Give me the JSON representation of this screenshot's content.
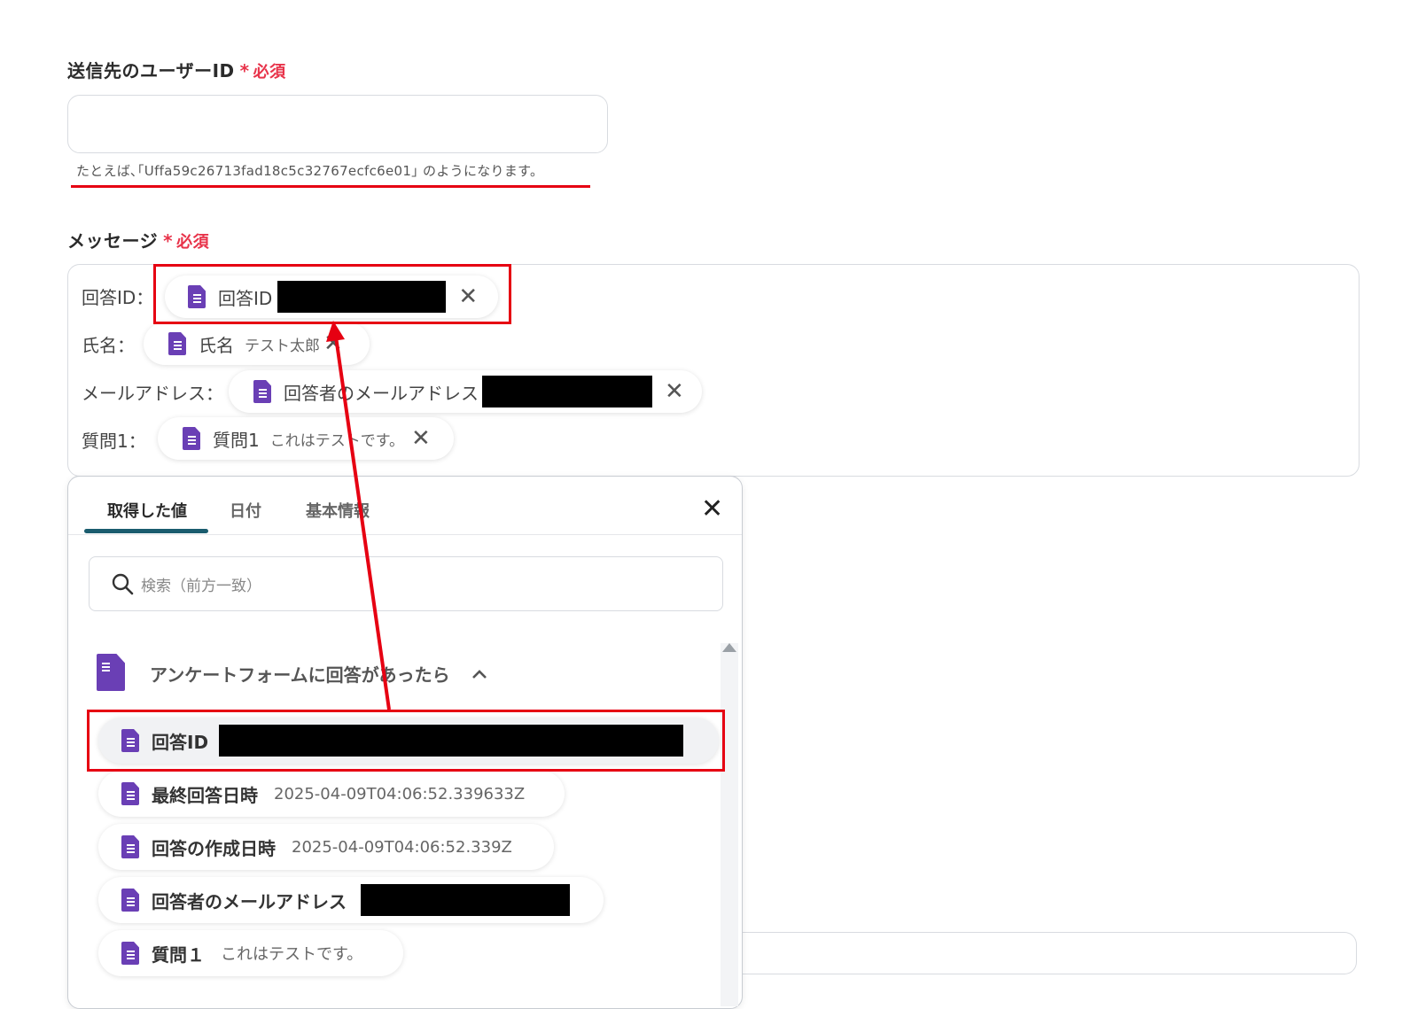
{
  "user_id_field": {
    "label": "送信先のユーザーID",
    "required_star": "*",
    "required_text": "必須",
    "value": "",
    "hint": "たとえば､｢Uffa59c26713fad18c5c32767ecfc6e01｣ のようになります。"
  },
  "message_field": {
    "label": "メッセージ",
    "required_star": "*",
    "required_text": "必須",
    "rows": [
      {
        "label": "回答ID：",
        "chip_title": "回答ID",
        "chip_value": ""
      },
      {
        "label": "氏名：",
        "chip_title": "氏名",
        "chip_value": "テスト太郎"
      },
      {
        "label": "メールアドレス：",
        "chip_title": "回答者のメールアドレス",
        "chip_value": ""
      },
      {
        "label": "質問1：",
        "chip_title": "質問1",
        "chip_value": "これはテストです。"
      }
    ]
  },
  "picker": {
    "tabs": [
      "取得した値",
      "日付",
      "基本情報"
    ],
    "active_tab": 0,
    "close_icon": "close-icon",
    "search_placeholder": "検索（前方一致）",
    "section_title": "アンケートフォームに回答があったら",
    "items": [
      {
        "title": "回答ID",
        "value": ""
      },
      {
        "title": "最終回答日時",
        "value": "2025-04-09T04:06:52.339633Z"
      },
      {
        "title": "回答の作成日時",
        "value": "2025-04-09T04:06:52.339Z"
      },
      {
        "title": "回答者のメールアドレス",
        "value": ""
      },
      {
        "title": "質問１",
        "value": "これはテストです。"
      }
    ]
  },
  "colors": {
    "annotation_red": "#e60012",
    "required_red": "#e8334a",
    "icon_purple": "#6a3fb5",
    "tab_underline": "#1a5c6e"
  }
}
